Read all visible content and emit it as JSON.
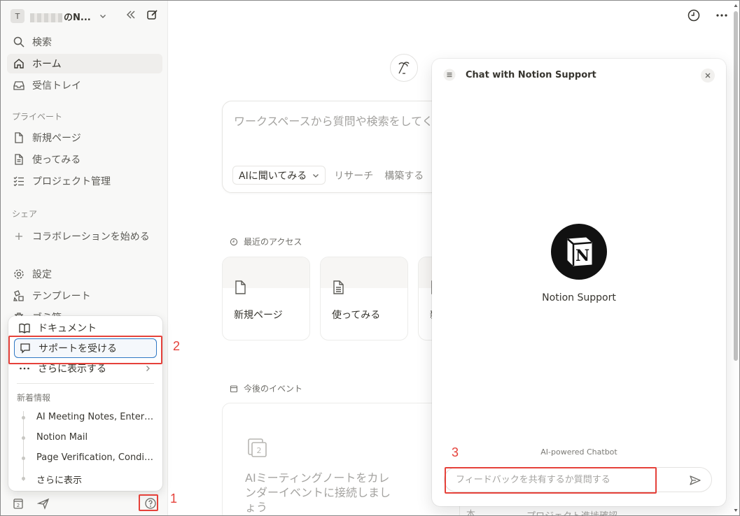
{
  "workspace": {
    "avatar_letter": "T",
    "name": "のN...",
    "chevron": "chevron-down-icon"
  },
  "sidebar": {
    "nav": [
      {
        "label": "検索",
        "icon": "search-icon"
      },
      {
        "label": "ホーム",
        "icon": "home-icon",
        "active": true
      },
      {
        "label": "受信トレイ",
        "icon": "inbox-icon"
      }
    ],
    "private_title": "プライベート",
    "private_items": [
      {
        "label": "新規ページ",
        "icon": "page-icon"
      },
      {
        "label": "使ってみる",
        "icon": "doc-icon"
      },
      {
        "label": "プロジェクト管理",
        "icon": "checklist-icon"
      }
    ],
    "share_title": "シェア",
    "share_items": [
      {
        "label": "コラボレーションを始める",
        "icon": "plus-icon"
      }
    ],
    "bottom_items": [
      {
        "label": "設定",
        "icon": "gear-icon"
      },
      {
        "label": "テンプレート",
        "icon": "template-icon"
      },
      {
        "label": "ゴミ箱",
        "icon": "trash-icon"
      }
    ]
  },
  "help_menu": {
    "items": [
      {
        "label": "ドキュメント",
        "icon": "book-icon"
      },
      {
        "label": "サポートを受ける",
        "icon": "chat-bubble-icon",
        "highlighted": true
      },
      {
        "label": "さらに表示する",
        "icon": "more-icon"
      }
    ],
    "news_title": "新着情報",
    "news": [
      "AI Meeting Notes, Enterp...",
      "Notion Mail",
      "Page Verification, Conditi...",
      "さらに表示"
    ]
  },
  "annotations": {
    "n1": "1",
    "n2": "2",
    "n3": "3",
    "color": "#e5413a"
  },
  "main": {
    "ai_box": {
      "placeholder": "ワークスペースから質問や検索をしてく",
      "mode": "AIに聞いてみる",
      "options": [
        "リサーチ",
        "構築する"
      ]
    },
    "recent_title": "最近のアクセス",
    "recent_cards": [
      {
        "title": "新規ページ",
        "icon": "page-icon"
      },
      {
        "title": "使ってみる",
        "icon": "doc-icon"
      },
      {
        "title": "新",
        "icon": "page-icon"
      }
    ],
    "events_title": "今後のイベント",
    "events_text": "AIミーティングノートをカレンダーイベントに接続しましょう",
    "events_footer": [
      "本",
      "プロジェクト進捗確認"
    ]
  },
  "chat": {
    "title": "Chat with Notion Support",
    "bot_name": "Notion Support",
    "logo_letter": "N",
    "powered": "AI-powered Chatbot",
    "input_placeholder": "フィードバックを共有するか質問する"
  },
  "colors": {
    "accent_blue": "#2f78c4",
    "sidebar_bg": "#f8f8f7",
    "annotation_red": "#e5413a"
  }
}
